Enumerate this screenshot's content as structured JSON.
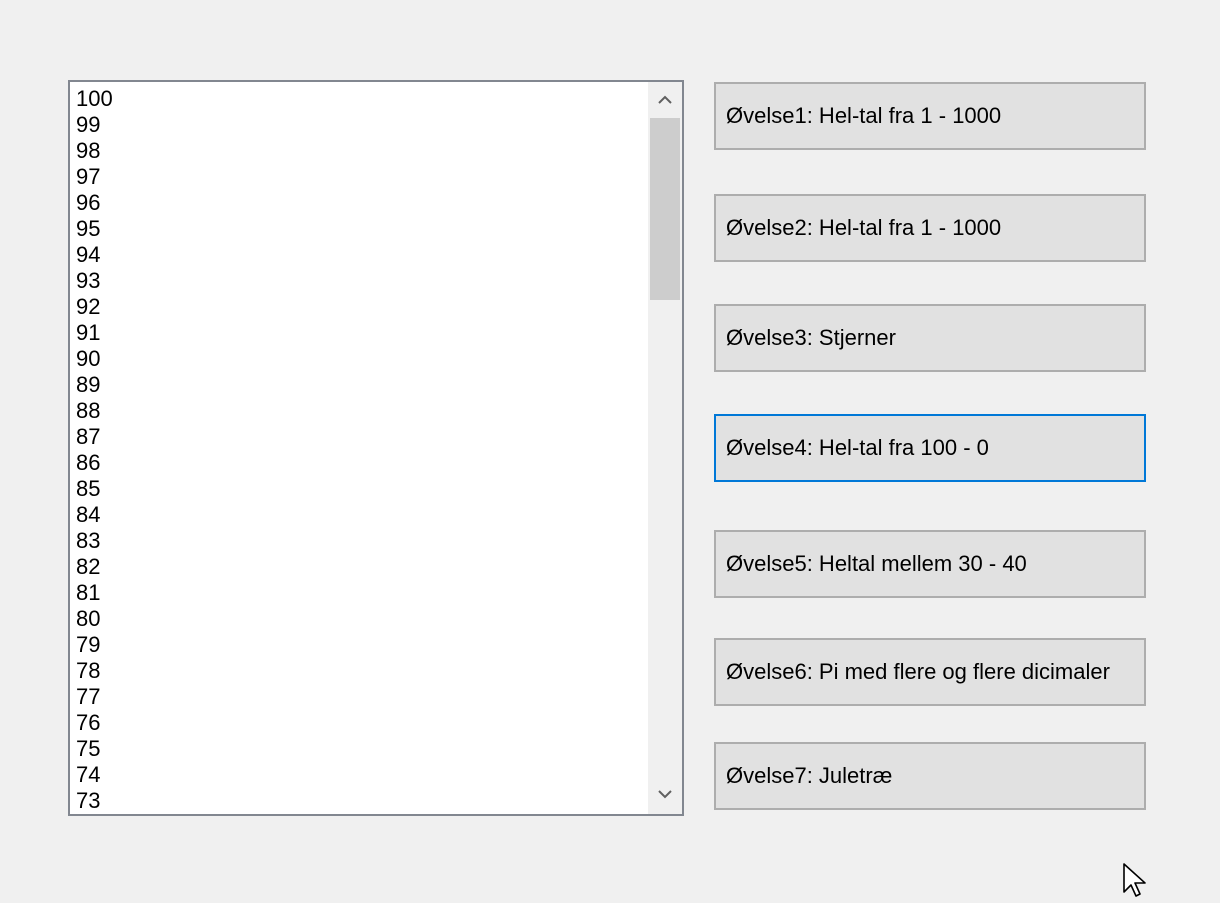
{
  "listbox": {
    "items": [
      "100",
      "99",
      "98",
      "97",
      "96",
      "95",
      "94",
      "93",
      "92",
      "91",
      "90",
      "89",
      "88",
      "87",
      "86",
      "85",
      "84",
      "83",
      "82",
      "81",
      "80",
      "79",
      "78",
      "77",
      "76",
      "75",
      "74",
      "73"
    ],
    "scroll_up_icon": "chevron-up-icon",
    "scroll_down_icon": "chevron-down-icon"
  },
  "buttons": [
    {
      "label": "Øvelse1: Hel-tal fra 1 - 1000"
    },
    {
      "label": "Øvelse2: Hel-tal fra 1 - 1000"
    },
    {
      "label": "Øvelse3: Stjerner"
    },
    {
      "label": "Øvelse4: Hel-tal fra 100 - 0",
      "focused": true
    },
    {
      "label": "Øvelse5: Heltal mellem 30 - 40"
    },
    {
      "label": "Øvelse6: Pi med flere og flere dicimaler"
    },
    {
      "label": "Øvelse7: Juletræ"
    }
  ],
  "colors": {
    "window_bg": "#f0f0f0",
    "button_bg": "#e1e1e1",
    "button_border": "#adadad",
    "focus_border": "#0078d7",
    "scroll_thumb": "#cdcdcd"
  },
  "cursor_icon": "mouse-pointer-icon"
}
